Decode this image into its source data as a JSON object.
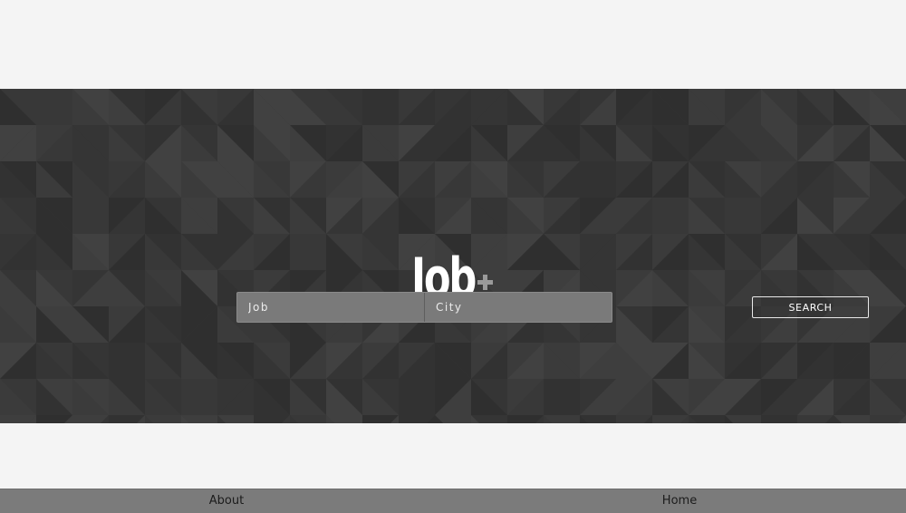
{
  "brand": {
    "logo_text": "Job",
    "logo_accent_icon": "plus-icon"
  },
  "search": {
    "job_placeholder": "Job",
    "city_placeholder": "City",
    "button_label": "SEARCH"
  },
  "footer": {
    "links": [
      {
        "label": "About"
      },
      {
        "label": "Home"
      }
    ]
  },
  "colors": {
    "page_background": "#f4f4f4",
    "hero_background": "#363636",
    "input_background": "#7a7a7a",
    "footer_background": "#7b7b7b",
    "logo_accent": "#9a9a9a"
  }
}
